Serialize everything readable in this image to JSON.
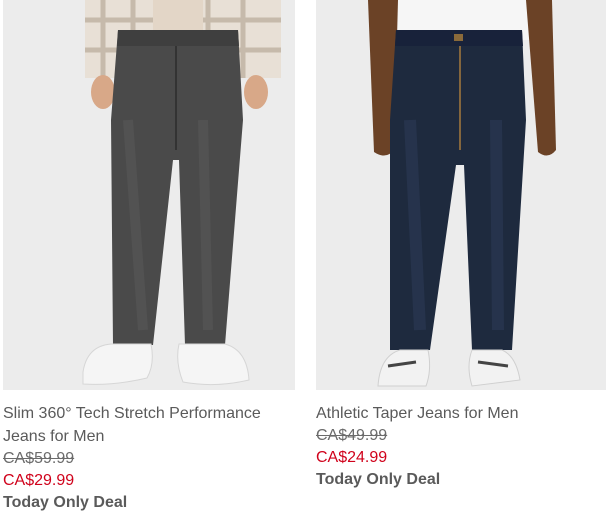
{
  "products": [
    {
      "name": "Slim 360° Tech Stretch Performance Jeans for Men",
      "original_price": "CA$59.99",
      "sale_price": "CA$29.99",
      "deal_label": "Today Only Deal",
      "image_alt": "grey-washed slim jeans with white sneakers"
    },
    {
      "name": "Athletic Taper Jeans for Men",
      "original_price": "CA$49.99",
      "sale_price": "CA$24.99",
      "deal_label": "Today Only Deal",
      "image_alt": "dark-wash athletic taper jeans with striped sneakers"
    }
  ],
  "colors": {
    "sale_red": "#d0021b",
    "text_gray": "#5a5a5a",
    "image_bg": "#ececec",
    "grey_denim": "#4a4a4a",
    "dark_denim": "#1e2a3e"
  }
}
